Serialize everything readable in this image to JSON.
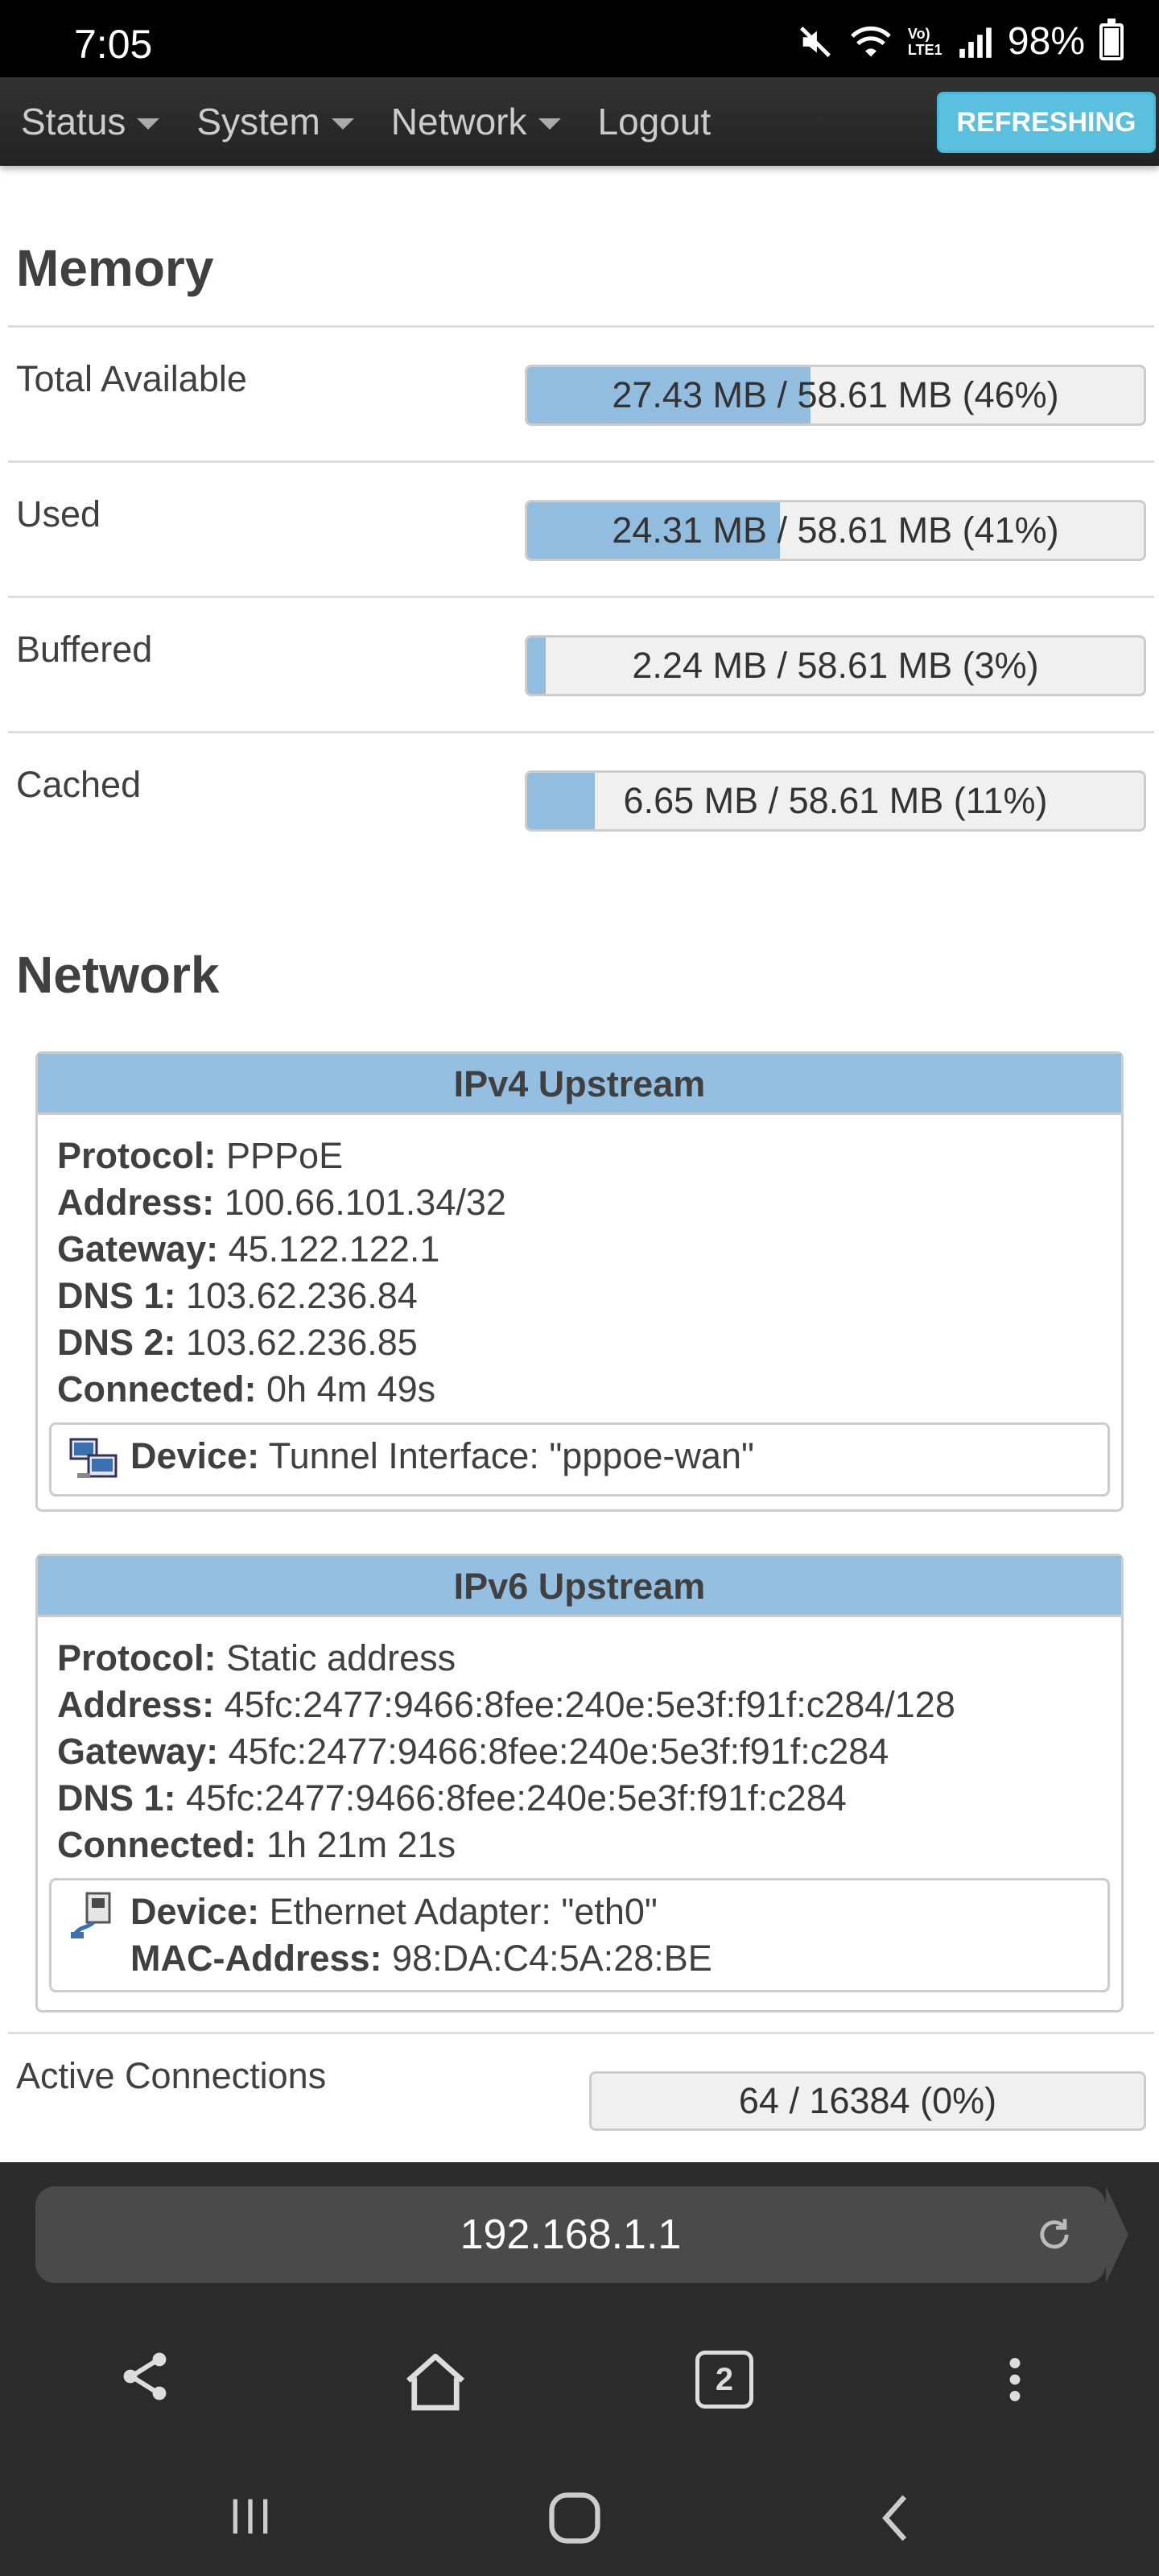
{
  "status_bar": {
    "time": "7:05",
    "battery": "98%",
    "volte": "Vo) LTE1"
  },
  "nav": {
    "items": [
      {
        "label": "Status"
      },
      {
        "label": "System"
      },
      {
        "label": "Network"
      },
      {
        "label": "Logout"
      }
    ],
    "refresh_button": "REFRESHING"
  },
  "memory": {
    "title": "Memory",
    "rows": [
      {
        "label": "Total Available",
        "value": "27.43 MB / 58.61 MB (46%)",
        "percent": 46
      },
      {
        "label": "Used",
        "value": "24.31 MB / 58.61 MB (41%)",
        "percent": 41
      },
      {
        "label": "Buffered",
        "value": "2.24 MB / 58.61 MB (3%)",
        "percent": 3
      },
      {
        "label": "Cached",
        "value": "6.65 MB / 58.61 MB (11%)",
        "percent": 11
      }
    ]
  },
  "network": {
    "title": "Network",
    "ipv4": {
      "header": "IPv4 Upstream",
      "fields": [
        {
          "key": "Protocol:",
          "value": "PPPoE"
        },
        {
          "key": "Address:",
          "value": "100.66.101.34/32"
        },
        {
          "key": "Gateway:",
          "value": "45.122.122.1"
        },
        {
          "key": "DNS 1:",
          "value": "103.62.236.84"
        },
        {
          "key": "DNS 2:",
          "value": "103.62.236.85"
        },
        {
          "key": "Connected:",
          "value": "0h 4m 49s"
        }
      ],
      "device_key": "Device:",
      "device_value": "Tunnel Interface: \"pppoe-wan\""
    },
    "ipv6": {
      "header": "IPv6 Upstream",
      "fields": [
        {
          "key": "Protocol:",
          "value": "Static address"
        },
        {
          "key": "Address:",
          "value": "45fc:2477:9466:8fee:240e:5e3f:f91f:c284/128"
        },
        {
          "key": "Gateway:",
          "value": "45fc:2477:9466:8fee:240e:5e3f:f91f:c284"
        },
        {
          "key": "DNS 1:",
          "value": "45fc:2477:9466:8fee:240e:5e3f:f91f:c284"
        },
        {
          "key": "Connected:",
          "value": "1h 21m 21s"
        }
      ],
      "device_key": "Device:",
      "device_value": "Ethernet Adapter: \"eth0\"",
      "mac_key": "MAC-Address:",
      "mac_value": "98:DA:C4:5A:28:BE"
    },
    "active_connections": {
      "label": "Active Connections",
      "value": "64 / 16384 (0%)",
      "percent": 0
    }
  },
  "browser": {
    "url": "192.168.1.1",
    "tab_count": "2"
  },
  "colors": {
    "bar_fill": "#93bddf",
    "box_header": "#94bfe1",
    "refresh": "#5bc0de"
  }
}
